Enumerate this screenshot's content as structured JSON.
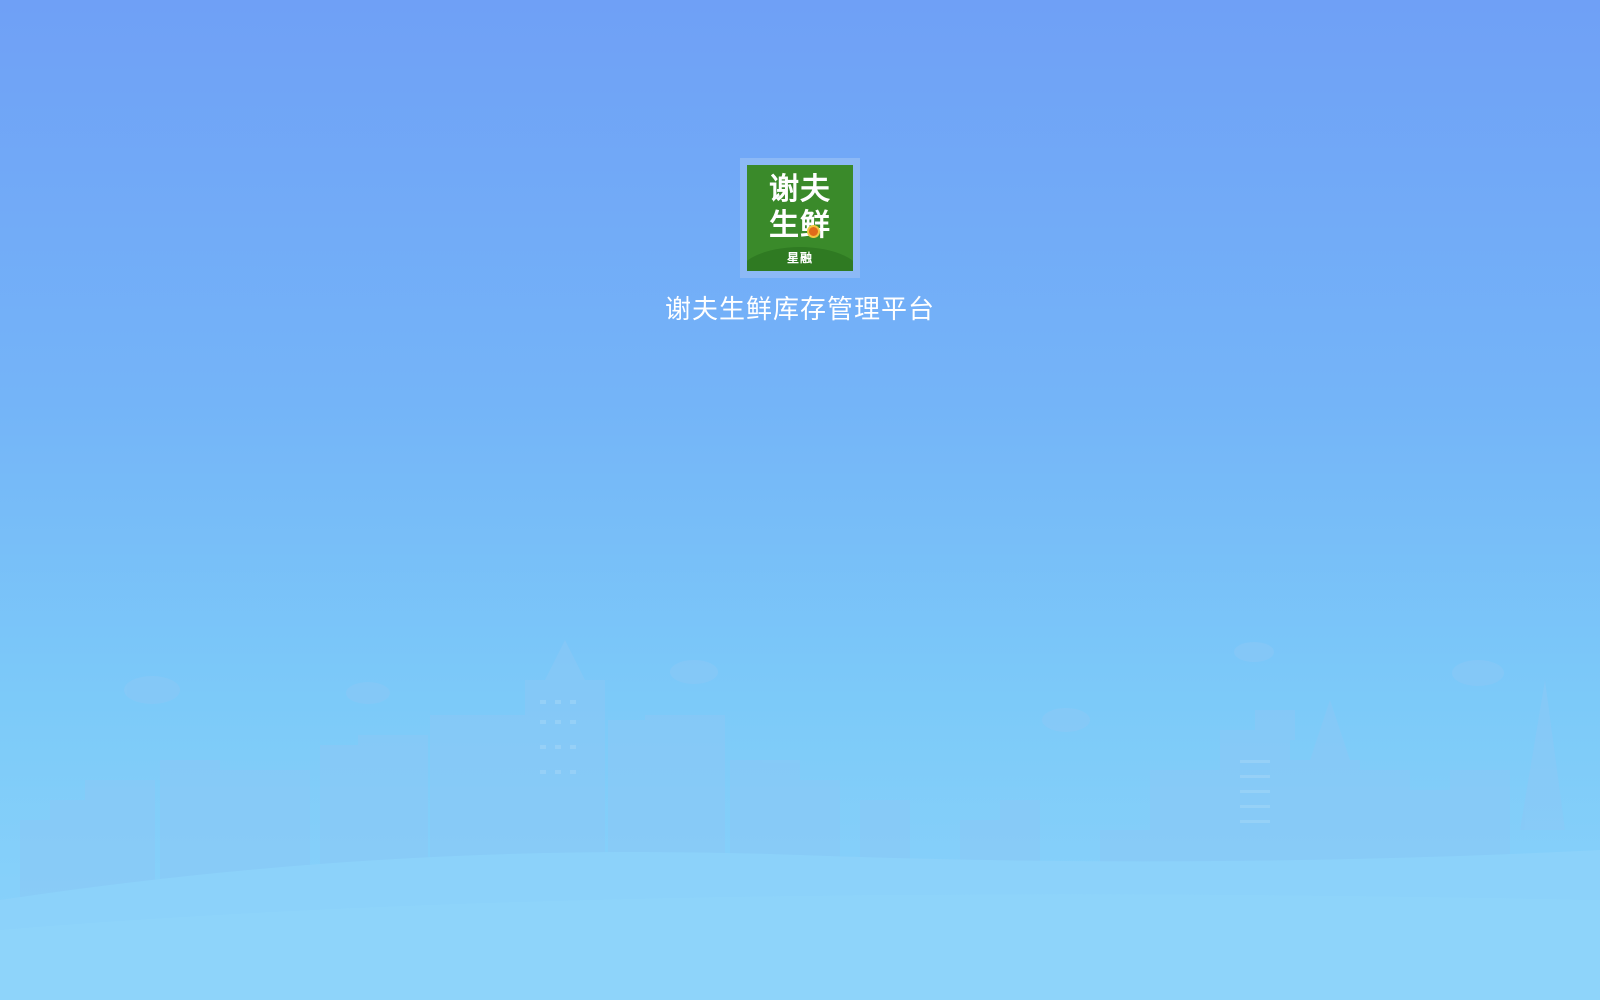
{
  "app": {
    "title": "谢夫生鲜库存管理平台"
  },
  "logo": {
    "line1": "谢夫",
    "line2": "生鲜",
    "tagline": "星融",
    "icon": "brand-logo-icon",
    "bg_color": "#3a8a2a",
    "frame_color": "#8cb9f6"
  },
  "background": {
    "illustration": "city-skyline-illustration",
    "gradient_top": "#6fa0f6",
    "gradient_bottom": "#8cd4fa"
  }
}
